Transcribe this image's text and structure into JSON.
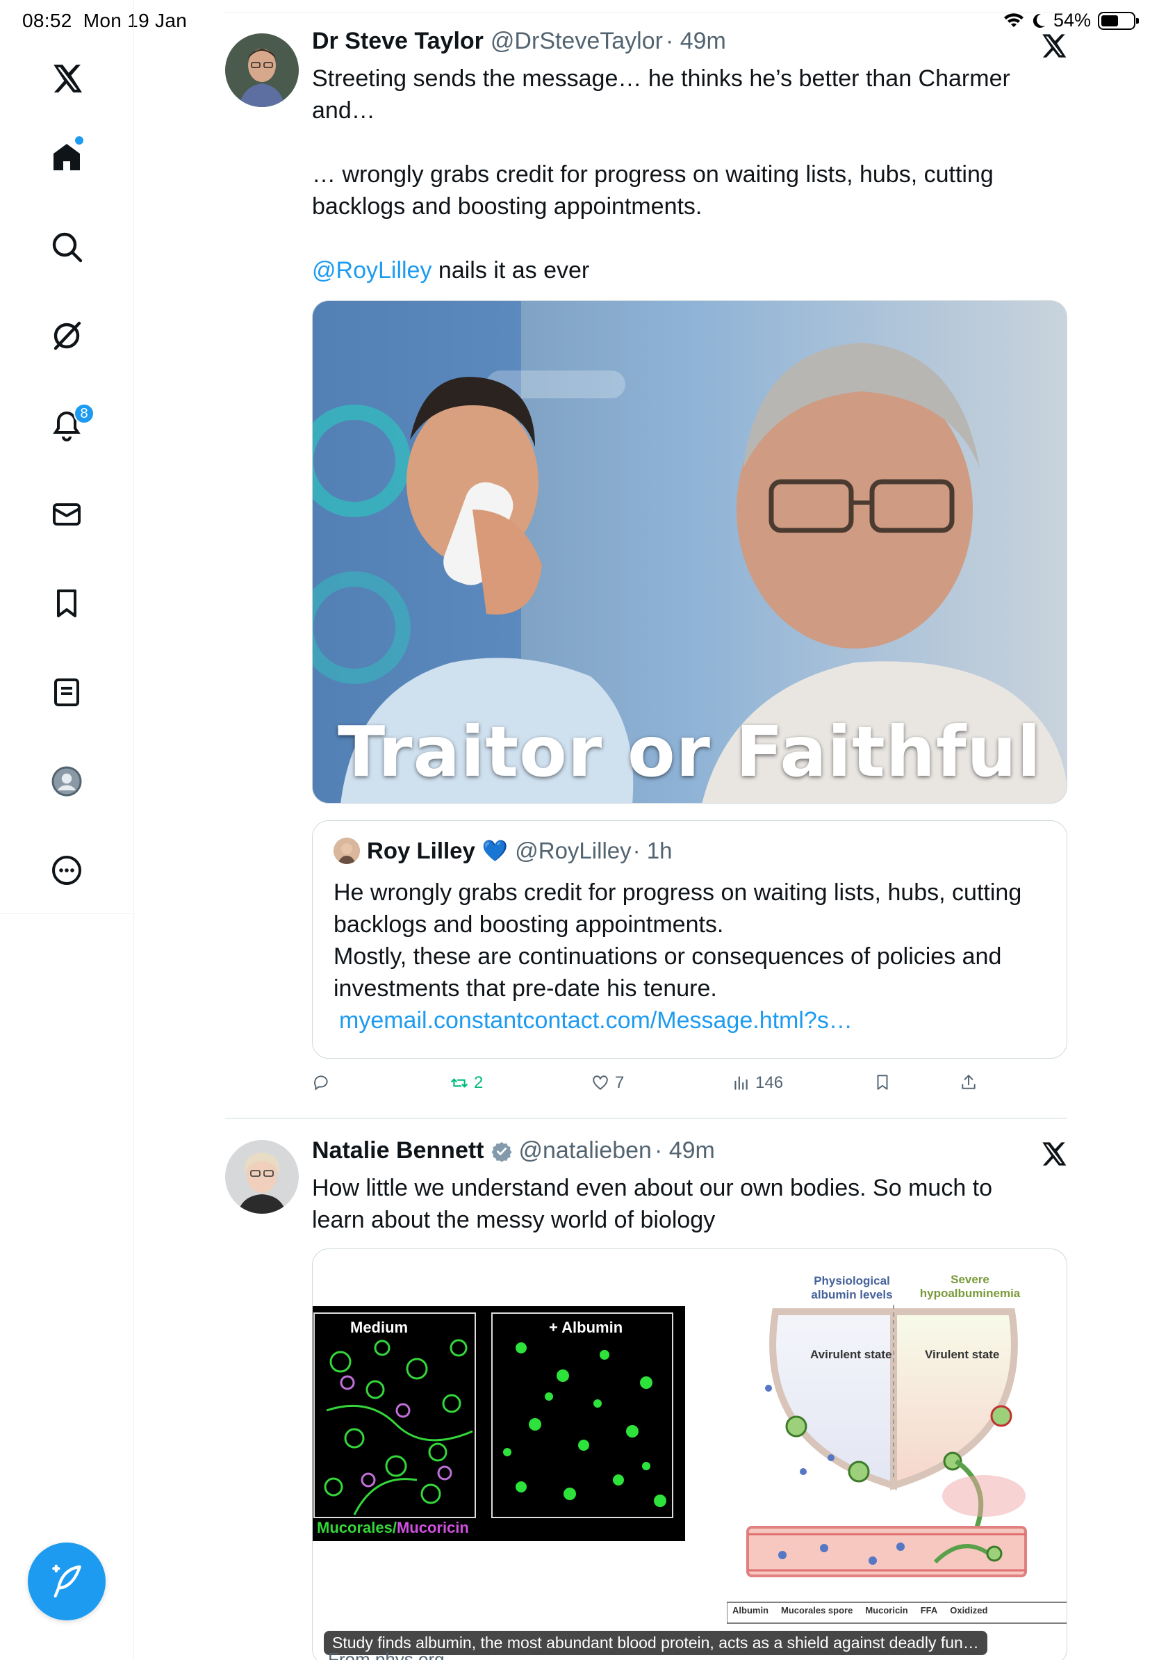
{
  "status_bar": {
    "time": "08:52",
    "date": "Mon 19 Jan",
    "battery": "54%",
    "battery_level": 0.54
  },
  "sidebar": {
    "items": [
      {
        "icon": "x-logo-icon"
      },
      {
        "icon": "home-icon",
        "has_dot": true
      },
      {
        "icon": "search-icon"
      },
      {
        "icon": "grok-icon"
      },
      {
        "icon": "bell-icon",
        "badge": "8"
      },
      {
        "icon": "mail-icon"
      },
      {
        "icon": "bookmark-icon"
      },
      {
        "icon": "list-icon"
      },
      {
        "icon": "profile-icon"
      },
      {
        "icon": "more-icon"
      }
    ],
    "notification_badge": "8",
    "compose_icon": "compose-feather-icon"
  },
  "tweets": [
    {
      "name": "Dr Steve Taylor",
      "handle": "@DrSteveTaylor",
      "time": "· 49m",
      "text_lines": [
        "Streeting sends the message… he thinks he’s better than Charmer and…",
        "… wrongly grabs credit for progress on waiting lists, hubs, cutting backlogs and boosting appointments."
      ],
      "mention": "@RoyLilley",
      "mention_suffix": " nails it as ever",
      "image_caption_text": "Traitor or Faithful",
      "quote": {
        "name": "Roy Lilley",
        "verified_heart": "💙",
        "handle": "@RoyLilley",
        "time": "· 1h",
        "text": "He wrongly grabs credit for progress on waiting lists, hubs, cutting backlogs and boosting appointments.",
        "text2": "Mostly, these are continuations or consequences of policies and investments that pre-date his tenure.",
        "link": "myemail.constantcontact.com/Message.html?s…"
      },
      "actions": {
        "replies": "",
        "reposts": "2",
        "likes": "7",
        "views": "146"
      }
    },
    {
      "name": "Natalie Bennett",
      "handle": "@natalieben",
      "time": "· 49m",
      "text": "How little we understand even about our own bodies. So much to learn about the messy world of biology",
      "card": {
        "left_panel_label_1": "Medium",
        "left_panel_label_2": "+ Albumin",
        "left_panel_footer_a": "Mucorales/",
        "left_panel_footer_b": "Mucoricin",
        "diagram_col1": "Physiological albumin levels",
        "diagram_col2": "Severe hypoalbuminemia",
        "state1": "Avirulent state",
        "state2": "Virulent state",
        "legend": [
          "Albumin",
          "Mucorales spore",
          "Mucoricin",
          "FFA",
          "Oxidized"
        ],
        "caption": "Study finds albumin, the most abundant blood protein, acts as a shield against deadly fun…",
        "source": "From phys.org"
      }
    }
  ],
  "colors": {
    "accent": "#1d9bf0",
    "repost": "#00ba7c",
    "muted": "#536471"
  }
}
